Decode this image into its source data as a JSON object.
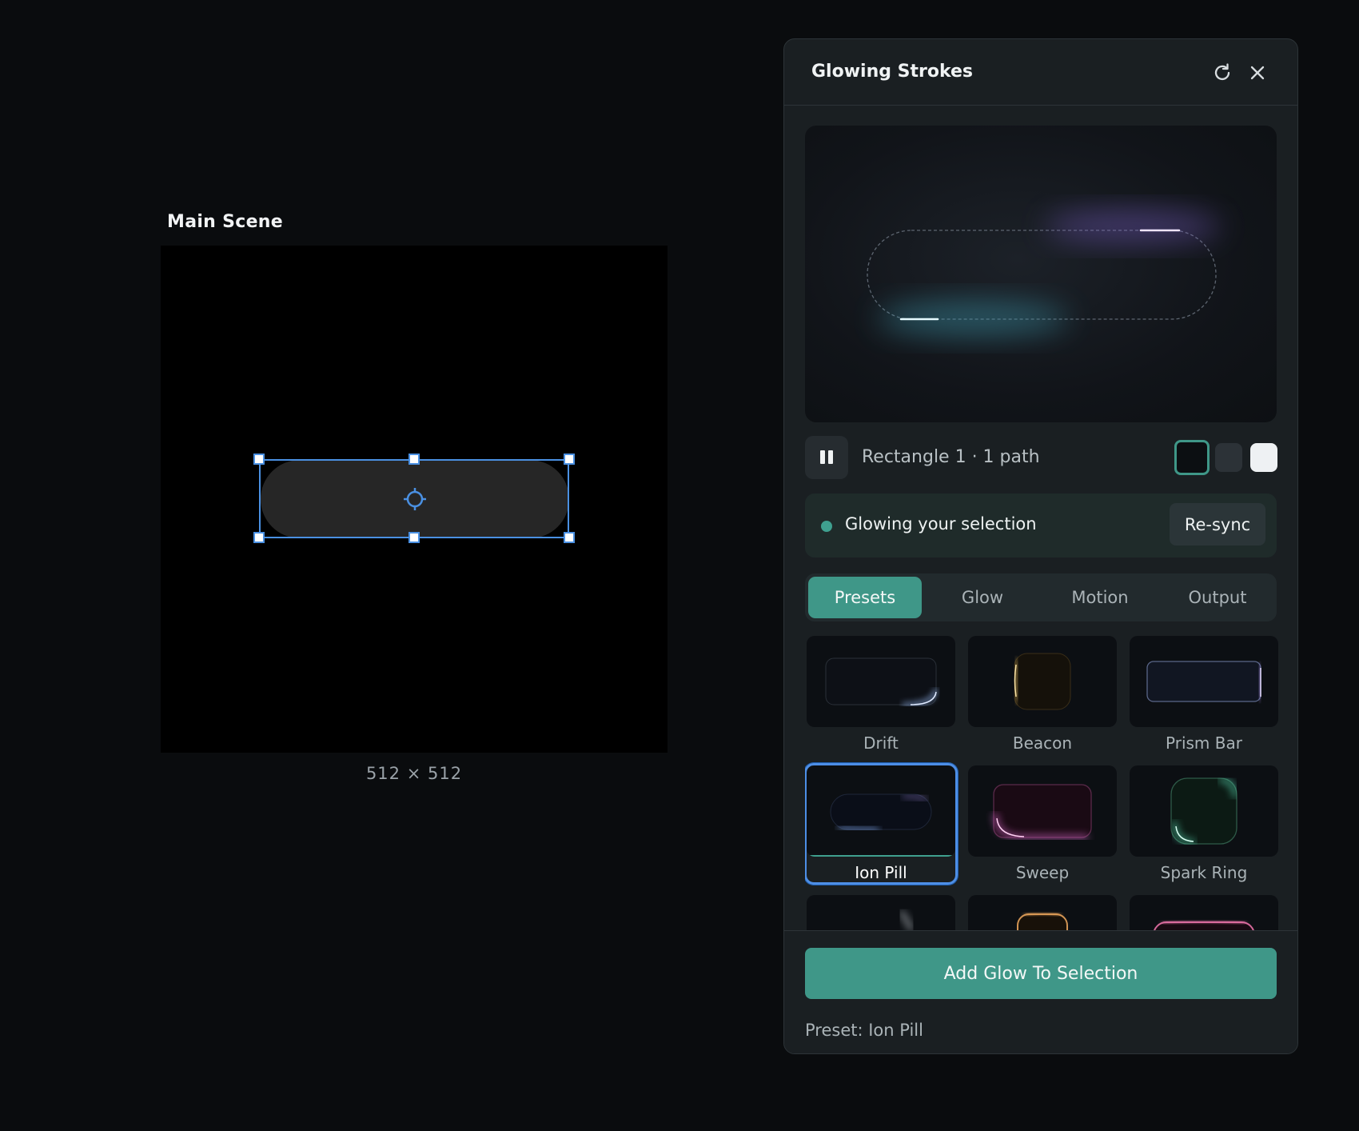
{
  "scene": {
    "title": "Main Scene",
    "size_label": "512 × 512"
  },
  "panel": {
    "title": "Glowing Strokes",
    "refresh_icon": "refresh-icon",
    "close_icon": "close-icon"
  },
  "layer": {
    "info": "Rectangle 1 · 1 path",
    "swatches": [
      {
        "name": "dark",
        "color": "#0c0f12",
        "selected": true
      },
      {
        "name": "gray",
        "color": "#2c3237",
        "selected": false
      },
      {
        "name": "light",
        "color": "#eef1f3",
        "selected": false
      }
    ]
  },
  "status": {
    "text": "Glowing your selection",
    "resync_label": "Re-sync"
  },
  "tabs": [
    {
      "label": "Presets",
      "active": true
    },
    {
      "label": "Glow",
      "active": false
    },
    {
      "label": "Motion",
      "active": false
    },
    {
      "label": "Output",
      "active": false
    }
  ],
  "presets": [
    {
      "label": "Drift",
      "glow": "#9fc3ff"
    },
    {
      "label": "Beacon",
      "glow": "#f0c86a"
    },
    {
      "label": "Prism Bar",
      "glow": "#b89cff"
    },
    {
      "label": "Ion Pill",
      "glow": "#8ab4ff",
      "selected": true
    },
    {
      "label": "Sweep",
      "glow": "#e06ad0"
    },
    {
      "label": "Spark Ring",
      "glow": "#5ae0b8"
    },
    {
      "label": "",
      "glow": "#cfd6dc"
    },
    {
      "label": "",
      "glow": "#e6a25a"
    },
    {
      "label": "",
      "glow": "#e872a8"
    }
  ],
  "footer": {
    "add_label": "Add Glow To Selection",
    "preset_line": "Preset: Ion Pill"
  },
  "colors": {
    "accent": "#3f9788",
    "selection_blue": "#4a90e2"
  }
}
